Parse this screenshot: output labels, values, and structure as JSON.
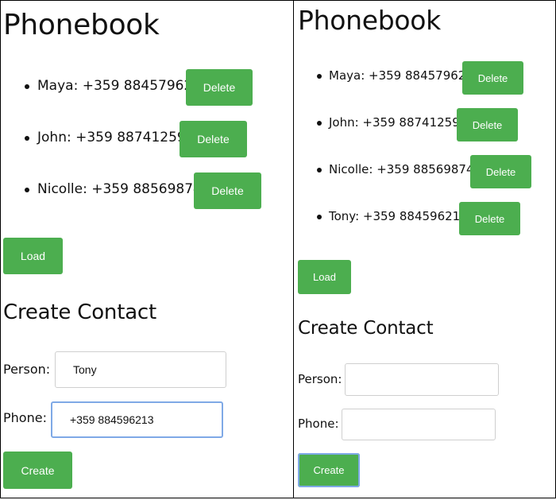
{
  "left": {
    "title": "Phonebook",
    "contacts": [
      {
        "text": "Maya: +359 884579625",
        "delete_label": "Delete"
      },
      {
        "text": "John: +359 887412598",
        "delete_label": "Delete"
      },
      {
        "text": "Nicolle: +359 885698742",
        "delete_label": "Delete"
      }
    ],
    "load_label": "Load",
    "create_title": "Create Contact",
    "person_label": "Person:",
    "person_value": "Tony",
    "phone_label": "Phone:",
    "phone_value": "+359 884596213",
    "create_label": "Create"
  },
  "right": {
    "title": "Phonebook",
    "contacts": [
      {
        "text": "Maya: +359 884579625",
        "delete_label": "Delete"
      },
      {
        "text": "John: +359 887412598",
        "delete_label": "Delete"
      },
      {
        "text": "Nicolle: +359 885698742",
        "delete_label": "Delete"
      },
      {
        "text": "Tony: +359 884596213",
        "delete_label": "Delete"
      }
    ],
    "load_label": "Load",
    "create_title": "Create Contact",
    "person_label": "Person:",
    "person_value": "",
    "phone_label": "Phone:",
    "phone_value": "",
    "create_label": "Create"
  },
  "colors": {
    "button_green": "#4cae4f",
    "focus_blue": "#7fa9e6"
  }
}
